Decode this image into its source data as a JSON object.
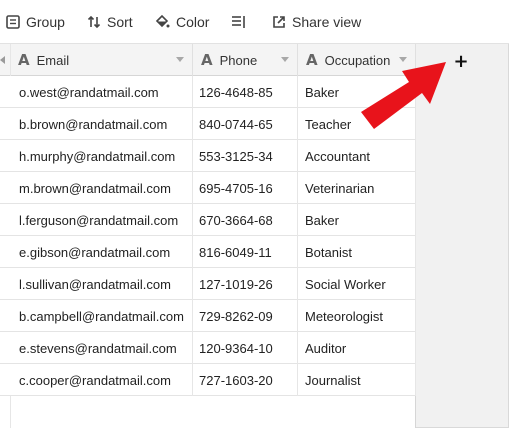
{
  "toolbar": {
    "group_label": "Group",
    "sort_label": "Sort",
    "color_label": "Color",
    "share_label": "Share view"
  },
  "columns": [
    {
      "label": "Email",
      "type_icon": "A"
    },
    {
      "label": "Phone",
      "type_icon": "A"
    },
    {
      "label": "Occupation",
      "type_icon": "A"
    }
  ],
  "rows": [
    {
      "email": "o.west@randatmail.com",
      "phone": "126-4648-85",
      "occupation": "Baker"
    },
    {
      "email": "b.brown@randatmail.com",
      "phone": "840-0744-65",
      "occupation": "Teacher"
    },
    {
      "email": "h.murphy@randatmail.com",
      "phone": "553-3125-34",
      "occupation": "Accountant"
    },
    {
      "email": "m.brown@randatmail.com",
      "phone": "695-4705-16",
      "occupation": "Veterinarian"
    },
    {
      "email": "l.ferguson@randatmail.com",
      "phone": "670-3664-68",
      "occupation": "Baker"
    },
    {
      "email": "e.gibson@randatmail.com",
      "phone": "816-6049-11",
      "occupation": "Botanist"
    },
    {
      "email": "l.sullivan@randatmail.com",
      "phone": "127-1019-26",
      "occupation": "Social Worker"
    },
    {
      "email": "b.campbell@randatmail.com",
      "phone": "729-8262-09",
      "occupation": "Meteorologist"
    },
    {
      "email": "e.stevens@randatmail.com",
      "phone": "120-9364-10",
      "occupation": "Auditor"
    },
    {
      "email": "c.cooper@randatmail.com",
      "phone": "727-1603-20",
      "occupation": "Journalist"
    }
  ],
  "add_field": {
    "label": "+"
  },
  "colors": {
    "arrow": "#e8131b",
    "header_bg": "#f4f4f4",
    "sidebar_bg": "#f1f1f1"
  },
  "icons": [
    "group-icon",
    "sort-icon",
    "color-icon",
    "row-height-icon",
    "share-icon",
    "text-field-icon",
    "chevron-down-icon",
    "red-arrow-annotation"
  ]
}
